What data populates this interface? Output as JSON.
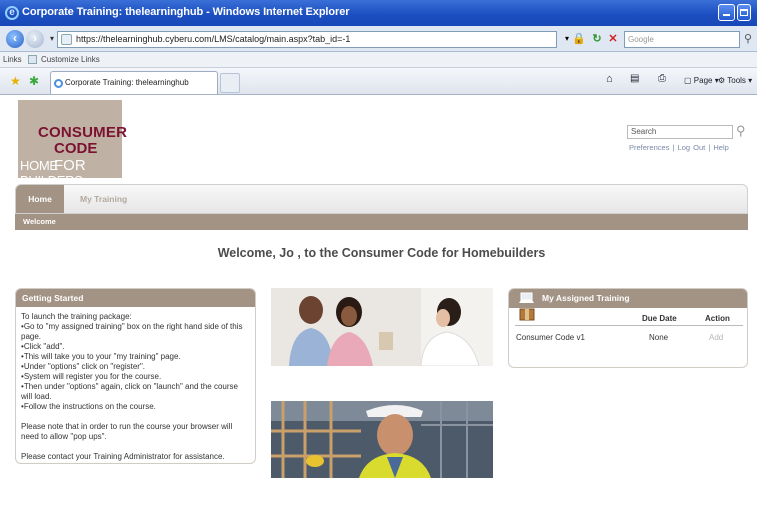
{
  "window": {
    "title": "Corporate Training: thelearninghub - Windows Internet Explorer"
  },
  "address": {
    "url": "https://thelearninghub.cyberu.com/LMS/catalog/main.aspx?tab_id=-1",
    "search_placeholder": "Google"
  },
  "links_bar": {
    "label": "Links",
    "item": "Customize Links"
  },
  "browser_tab": {
    "label": "Corporate Training: thelearninghub"
  },
  "commands": {
    "page": "Page",
    "tools": "Tools"
  },
  "logo": {
    "line1": "CONSUMER",
    "line2a": "CODE",
    "line2b": " FOR",
    "line3": "HOME BUILDERS"
  },
  "site": {
    "search_placeholder": "Search",
    "links": [
      "Preferences",
      "Log Out",
      "Help"
    ]
  },
  "nav": {
    "home": "Home",
    "my_training": "My Training",
    "section": "Welcome"
  },
  "welcome_text": "Welcome, Jo , to the Consumer Code for Homebuilders",
  "getting_started": {
    "title": "Getting Started",
    "intro": "To launch the training package:",
    "steps": [
      "Go to \"my assigned training\" box on the right hand side of this page.",
      "Click \"add\".",
      "This will take you to your \"my training\" page.",
      "Under \"options\" click on \"register\".",
      "System will register you for the course.",
      "Then under \"options\" again, click on \"launch\" and the course will load.",
      "Follow the instructions on the course."
    ],
    "note": "Please note that in order to run the course your browser will need to allow \"pop ups\".",
    "contact": "Please contact your Training Administrator for assistance."
  },
  "assigned": {
    "title": "My Assigned Training",
    "col_due": "Due Date",
    "col_action": "Action",
    "rows": [
      {
        "course": "Consumer Code v1",
        "due": "None",
        "action": "Add"
      }
    ]
  },
  "colors": {
    "accent": "#a39384",
    "brand_maroon": "#7a1230",
    "ie_title": "#1c4fc0"
  }
}
